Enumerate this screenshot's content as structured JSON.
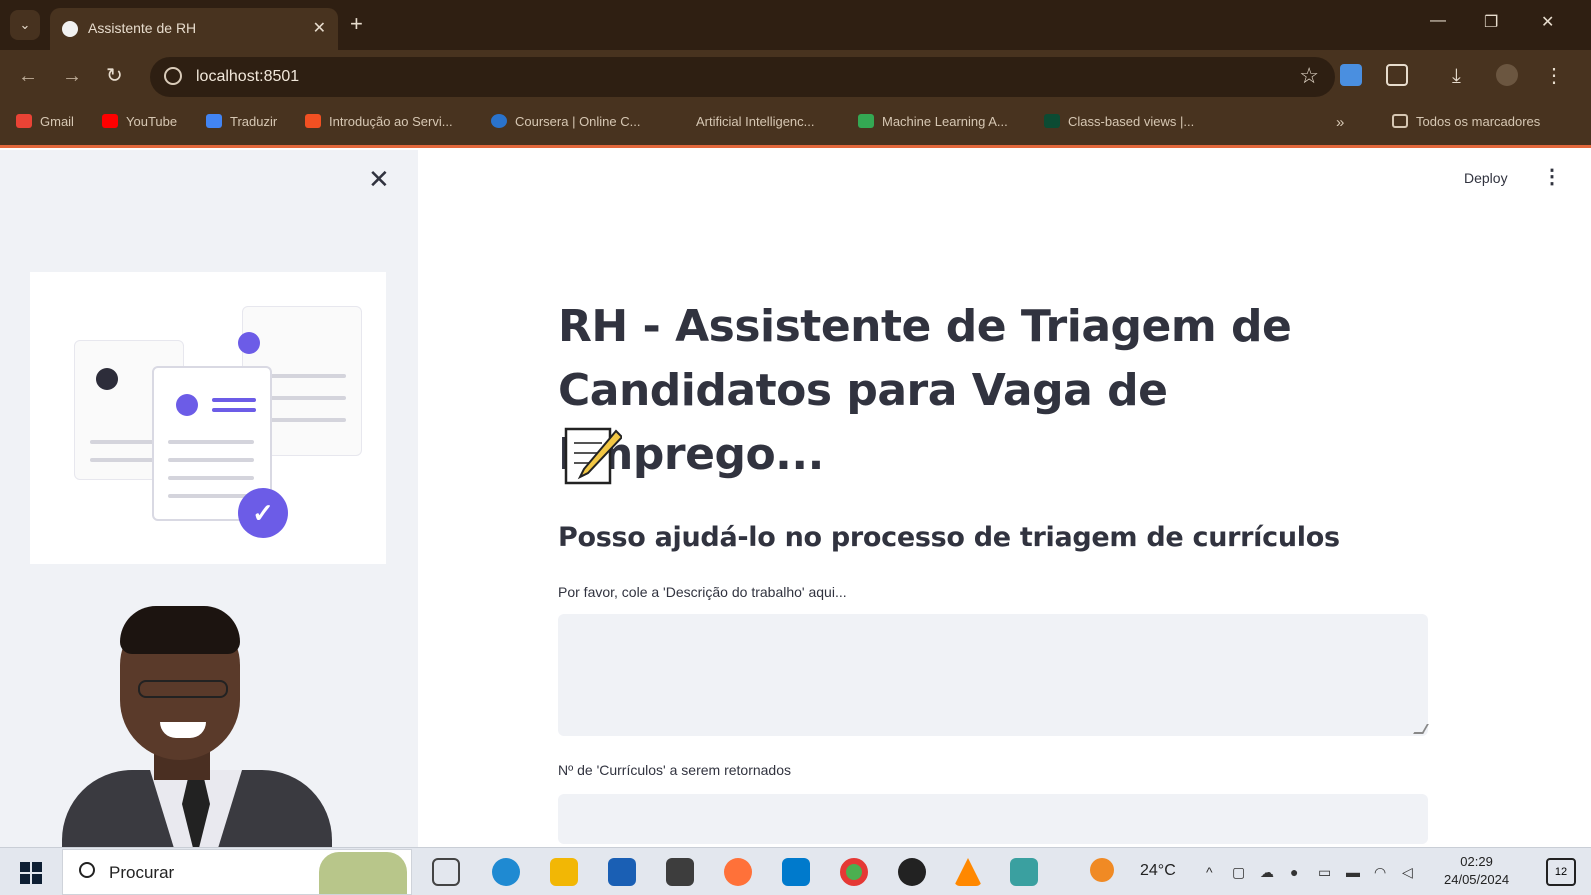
{
  "browser": {
    "tab_title": "Assistente de RH",
    "url": "localhost:8501",
    "bookmarks": [
      {
        "label": "Gmail",
        "color": "#ea4335"
      },
      {
        "label": "YouTube",
        "color": "#ff0000"
      },
      {
        "label": "Traduzir",
        "color": "#4285f4"
      },
      {
        "label": "Introdução ao Servi...",
        "color": "#f25022"
      },
      {
        "label": "Coursera | Online C...",
        "color": "#2a73cc"
      },
      {
        "label": "Artificial Intelligenc...",
        "color": "#48331f"
      },
      {
        "label": "Machine Learning A...",
        "color": "#34a853"
      },
      {
        "label": "Class-based views |...",
        "color": "#0c4b33"
      }
    ],
    "all_bookmarks": "Todos os marcadores"
  },
  "app": {
    "deploy_label": "Deploy",
    "title": "RH - Assistente de Triagem de Candidatos para Vaga de Emprego...",
    "subtitle": "Posso ajudá-lo no processo de triagem de currículos",
    "job_description_label": "Por favor, cole a 'Descrição do trabalho' aqui...",
    "resume_count_label": "Nº de 'Currículos' a serem retornados",
    "job_description_value": ""
  },
  "taskbar": {
    "search_placeholder": "Procurar",
    "temperature": "24°C",
    "time": "02:29",
    "date": "24/05/2024",
    "notification_count": "12"
  },
  "colors": {
    "accent": "#6c5ce7",
    "sidebar_bg": "#f0f2f6",
    "chrome_bg": "#48331f",
    "text": "#31333f"
  }
}
